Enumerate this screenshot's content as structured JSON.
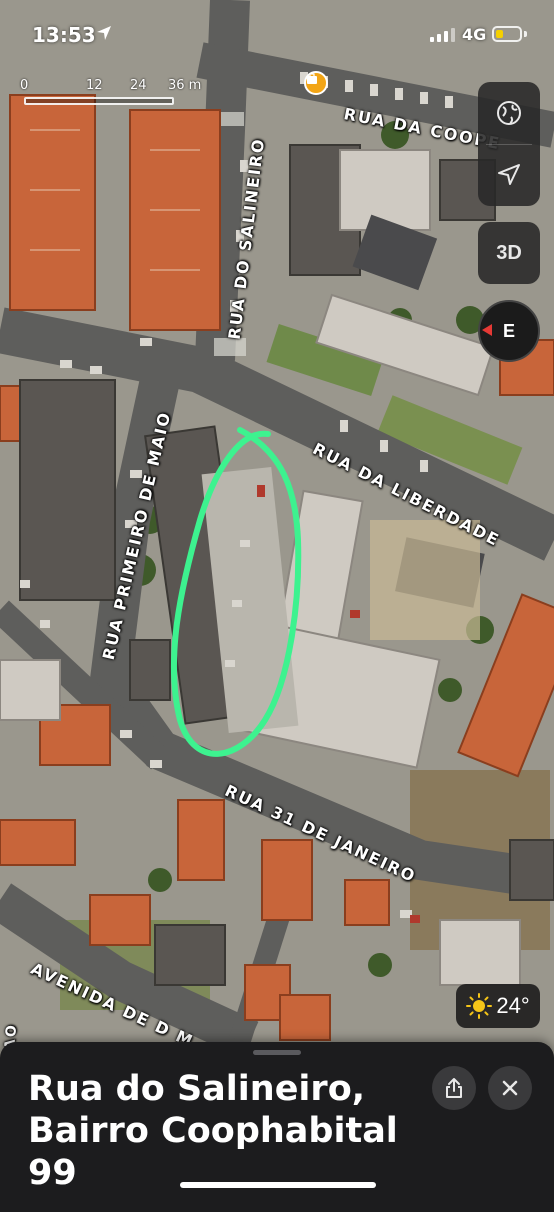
{
  "status_bar": {
    "time": "13:53",
    "network": "4G",
    "battery_level": 0.3
  },
  "scale_bar": {
    "ticks": [
      "0",
      "12",
      "24",
      "36 m"
    ]
  },
  "map_controls": {
    "globe_icon": "globe-icon",
    "location_icon": "location-arrow-icon",
    "view_3d_label": "3D",
    "compass_heading": "E"
  },
  "street_labels": {
    "rua_da_cooperativa": "RUA DA COOPE",
    "rua_do_salineiro": "RUA DO SALINEIRO",
    "rua_da_liberdade": "RUA DA LIBERDADE",
    "rua_primeiro_de_maio": "RUA PRIMEIRO DE MAIO",
    "rua_31_de_janeiro": "RUA 31 DE JANEIRO",
    "avenida_de_d": "AVENIDA DE D M",
    "left_edge_fragment": "AO"
  },
  "weather": {
    "icon": "sun-icon",
    "temperature": "24°"
  },
  "place_card": {
    "title": "Rua do Salineiro, Bairro Coophabital 99",
    "share_icon": "share-icon",
    "close_icon": "close-icon"
  },
  "colors": {
    "annotation": "#3df28f",
    "compass_needle": "#e53935",
    "weather_sun": "#f5c518",
    "battery": "#f5d000",
    "roof_terracotta": "#c8653a",
    "sheet_background": "#1c1c1e"
  }
}
